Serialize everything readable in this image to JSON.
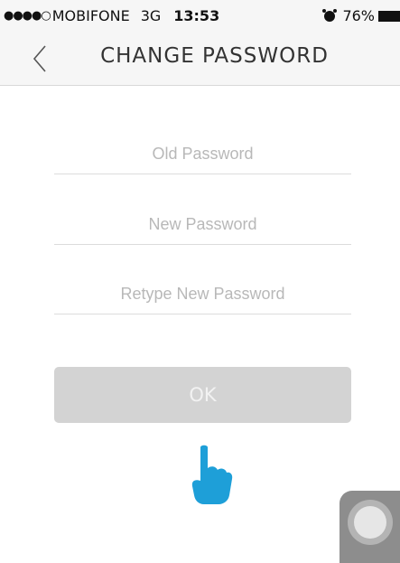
{
  "status_bar": {
    "signal": "●●●●○",
    "carrier": "MOBIFONE",
    "network": "3G",
    "time": "13:53",
    "battery": "76%"
  },
  "header": {
    "back_icon": "chevron-left-icon",
    "title": "CHANGE PASSWORD"
  },
  "form": {
    "old_password_placeholder": "Old Password",
    "new_password_placeholder": "New Password",
    "retype_password_placeholder": "Retype New Password",
    "ok_label": "OK"
  },
  "colors": {
    "accent_hand": "#1e9fd8",
    "button_disabled": "#d3d3d3"
  }
}
